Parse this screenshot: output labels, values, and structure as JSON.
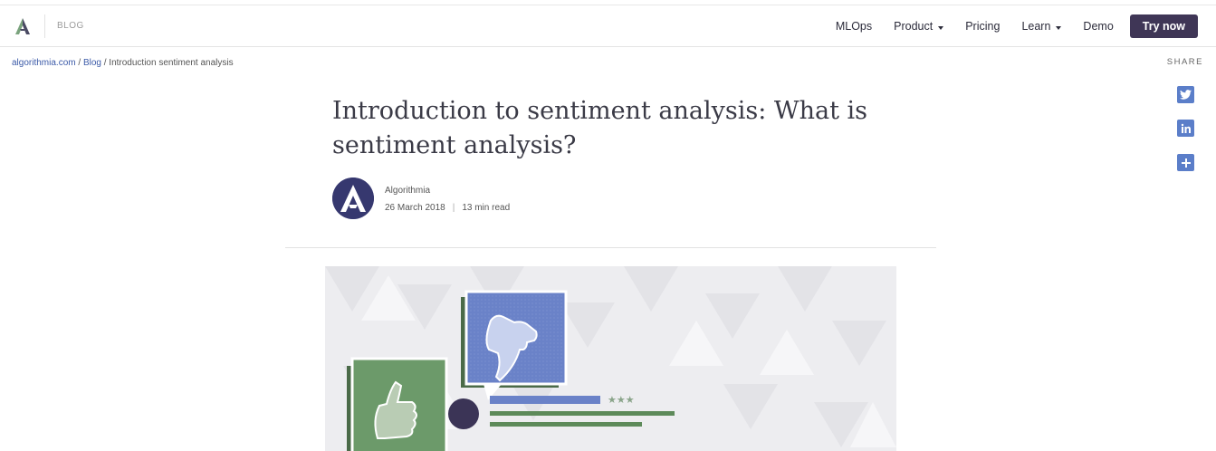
{
  "header": {
    "blog_label": "BLOG",
    "nav": {
      "mlops": "MLOps",
      "product": "Product",
      "pricing": "Pricing",
      "learn": "Learn",
      "demo": "Demo",
      "try_now": "Try now"
    }
  },
  "breadcrumb": {
    "home": "algorithmia.com",
    "sep1": " / ",
    "blog": "Blog",
    "sep2": " / ",
    "current": "Introduction sentiment analysis"
  },
  "share": {
    "label": "SHARE",
    "icons": [
      "twitter-icon",
      "linkedin-icon",
      "plus-icon"
    ]
  },
  "article": {
    "title": "Introduction to sentiment analysis: What is sentiment analysis?",
    "author": "Algorithmia",
    "date": "26 March 2018",
    "separator": "|",
    "read_time": "13 min read"
  },
  "colors": {
    "brand_dark": "#3f3656",
    "link_blue": "#3b5aa8",
    "share_blue": "#5b7ec9",
    "hero_green": "#6c9a6a",
    "hero_blue": "#6a82c8"
  }
}
